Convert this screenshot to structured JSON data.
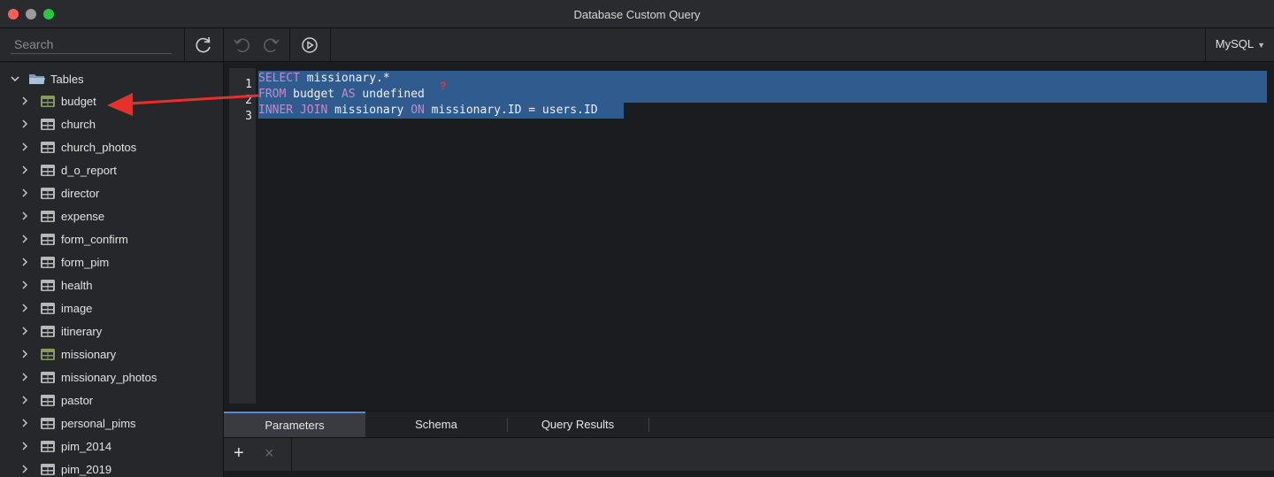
{
  "window": {
    "title": "Database Custom Query"
  },
  "toolbar": {
    "search_placeholder": "Search",
    "dialect": "MySQL",
    "icons": [
      "refresh-icon",
      "undo-icon",
      "redo-icon",
      "run-icon"
    ]
  },
  "sidebar": {
    "root_label": "Tables",
    "tables": [
      {
        "label": "budget",
        "highlighted": true
      },
      {
        "label": "church",
        "highlighted": false
      },
      {
        "label": "church_photos",
        "highlighted": false
      },
      {
        "label": "d_o_report",
        "highlighted": false
      },
      {
        "label": "director",
        "highlighted": false
      },
      {
        "label": "expense",
        "highlighted": false
      },
      {
        "label": "form_confirm",
        "highlighted": false
      },
      {
        "label": "form_pim",
        "highlighted": false
      },
      {
        "label": "health",
        "highlighted": false
      },
      {
        "label": "image",
        "highlighted": false
      },
      {
        "label": "itinerary",
        "highlighted": false
      },
      {
        "label": "missionary",
        "highlighted": true
      },
      {
        "label": "missionary_photos",
        "highlighted": false
      },
      {
        "label": "pastor",
        "highlighted": false
      },
      {
        "label": "personal_pims",
        "highlighted": false
      },
      {
        "label": "pim_2014",
        "highlighted": false
      },
      {
        "label": "pim_2019",
        "highlighted": false
      }
    ]
  },
  "editor": {
    "line_numbers": [
      "1",
      "2",
      "3"
    ],
    "lines": [
      {
        "kw1": "SELECT",
        "rest1": " missionary.*"
      },
      {
        "kw1": "FROM",
        "rest1": " budget ",
        "kw2": "AS",
        "rest2": " undefined"
      },
      {
        "kw1": "INNER JOIN",
        "rest1": " missionary ",
        "kw2": "ON",
        "rest2": " missionary.ID = users.ID"
      }
    ],
    "error_marker": "?"
  },
  "bottom": {
    "tabs": [
      "Parameters",
      "Schema",
      "Query Results"
    ],
    "active_tab": "Parameters",
    "add_label": "+",
    "remove_label": "×"
  },
  "colors": {
    "keyword": "#c58ac8",
    "selection": "#2f5b8e",
    "annotation_arrow": "#e8302a",
    "table_icon_highlight": "#8a9a5b"
  }
}
